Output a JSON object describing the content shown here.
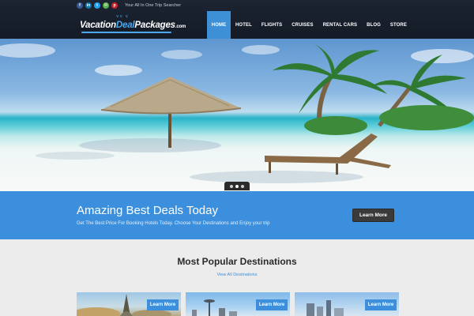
{
  "topbar": {
    "social": [
      {
        "name": "facebook-icon",
        "glyph": "f",
        "color": "#3b5998"
      },
      {
        "name": "linkedin-icon",
        "glyph": "in",
        "color": "#0e76a8"
      },
      {
        "name": "twitter-icon",
        "glyph": "t",
        "color": "#1da1f2"
      },
      {
        "name": "email-icon",
        "glyph": "✉",
        "color": "#5cae4a"
      },
      {
        "name": "pinterest-icon",
        "glyph": "p",
        "color": "#cb2027"
      }
    ],
    "tagline": "Your All In One Trip Searcher"
  },
  "logo": {
    "part1": "Vacation",
    "part2": "Deal",
    "part3": "Packages",
    "suffix": ".com"
  },
  "nav": {
    "home": "HOME",
    "hotel": "HOTEL",
    "flights": "FLIGHTS",
    "cruises": "CRUISES",
    "rental_cars": "RENTAL CARS",
    "blog": "BLOG",
    "store": "STORE"
  },
  "hero": {
    "slides_count": 3,
    "active_slide": 2
  },
  "promo": {
    "title": "Amazing Best Deals Today",
    "subtitle": "Get The Best Price For Booking Hotels Today. Choose Your Destinations and Enjoy your trip",
    "button": "Learn More"
  },
  "destinations": {
    "title": "Most Popular Destinations",
    "link": "View All Destinations",
    "cards": [
      {
        "button": "Learn More"
      },
      {
        "button": "Learn More"
      },
      {
        "button": "Learn More"
      }
    ]
  },
  "colors": {
    "accent": "#3b8fdc",
    "header_bg": "#1a2230",
    "button_dark": "#3a3a3a"
  }
}
